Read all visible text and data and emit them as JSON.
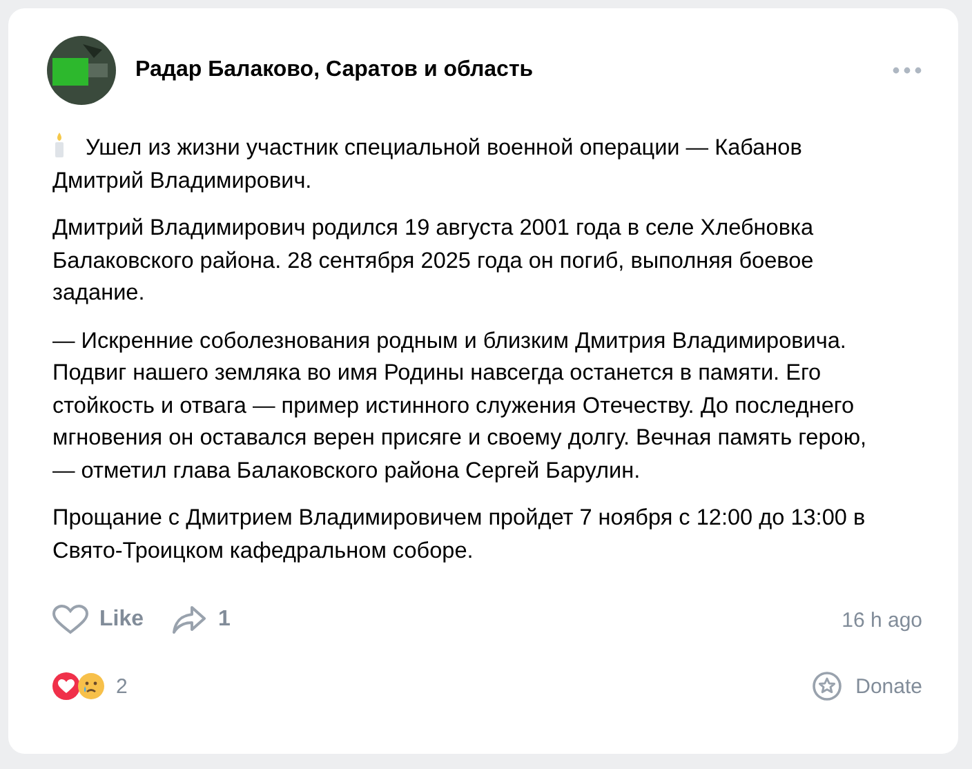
{
  "post": {
    "author": "Радар Балаково, Саратов и область",
    "paragraphs": [
      "Ушел из жизни участник специальной военной операции — Кабанов Дмитрий Владимирович.",
      "Дмитрий Владимирович родился 19 августа 2001 года в селе Хлебновка Балаковского района. 28 сентября 2025 года он погиб, выполняя боевое задание.",
      "— Искренние соболезнования родным и близким Дмитрия Владимировича. Подвиг нашего земляка во имя Родины навсегда останется в памяти. Его стойкость и отвага — пример истинного служения Отечеству. До последнего мгновения он оставался верен присяге и своему долгу. Вечная память герою, — отметил глава Балаковского района Сергей Барулин.",
      "Прощание с Дмитрием Владимировичем пройдет 7 ноября с 12:00 до 13:00 в Свято-Троицком кафедральном соборе."
    ],
    "like": {
      "label": "Like",
      "liked": false
    },
    "shares": "1",
    "time": "16 h ago",
    "reactions_count": "2",
    "donate": "Donate"
  }
}
